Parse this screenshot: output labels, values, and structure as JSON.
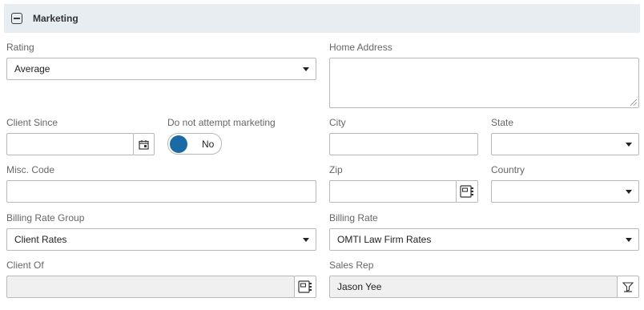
{
  "section": {
    "title": "Marketing",
    "icon": "collapse-minus-icon"
  },
  "fields": {
    "rating": {
      "label": "Rating",
      "value": "Average"
    },
    "home_address": {
      "label": "Home Address",
      "value": ""
    },
    "client_since": {
      "label": "Client Since",
      "value": ""
    },
    "do_not_market": {
      "label": "Do not attempt marketing",
      "value": "No"
    },
    "city": {
      "label": "City",
      "value": ""
    },
    "state": {
      "label": "State",
      "value": ""
    },
    "misc_code": {
      "label": "Misc. Code",
      "value": ""
    },
    "zip": {
      "label": "Zip",
      "value": ""
    },
    "country": {
      "label": "Country",
      "value": ""
    },
    "billing_rate_group": {
      "label": "Billing Rate Group",
      "value": "Client Rates"
    },
    "billing_rate": {
      "label": "Billing Rate",
      "value": "OMTI Law Firm Rates"
    },
    "client_of": {
      "label": "Client Of",
      "value": ""
    },
    "sales_rep": {
      "label": "Sales Rep",
      "value": "Jason Yee"
    }
  },
  "icons": {
    "calendar": "calendar-icon",
    "lookup": "address-book-icon",
    "filter": "filter-clear-icon"
  },
  "colors": {
    "header_bg": "#e8edf2",
    "toggle_knob": "#1a6aa6",
    "disabled_bg": "#f0f0f0"
  }
}
